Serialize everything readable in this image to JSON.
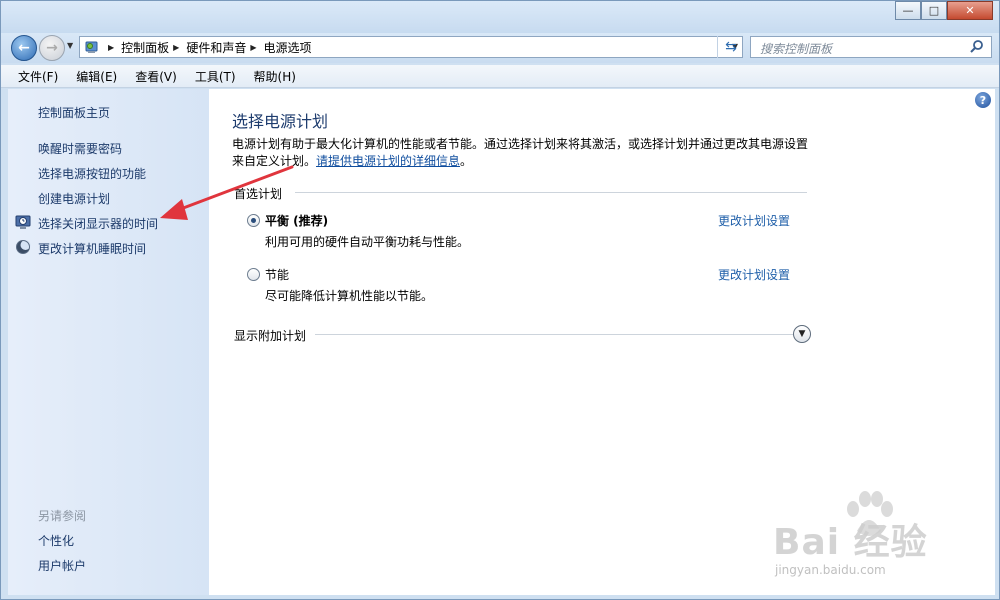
{
  "window": {
    "controls": [
      "minimize",
      "maximize",
      "close"
    ]
  },
  "navigation": {
    "breadcrumbs": [
      "控制面板",
      "硬件和声音",
      "电源选项"
    ],
    "search_placeholder": "搜索控制面板"
  },
  "menu": [
    "文件(F)",
    "编辑(E)",
    "查看(V)",
    "工具(T)",
    "帮助(H)"
  ],
  "sidebar": {
    "home": "控制面板主页",
    "links": [
      {
        "label": "唤醒时需要密码",
        "icon": ""
      },
      {
        "label": "选择电源按钮的功能",
        "icon": ""
      },
      {
        "label": "创建电源计划",
        "icon": ""
      },
      {
        "label": "选择关闭显示器的时间",
        "icon": "monitor-clock-icon"
      },
      {
        "label": "更改计算机睡眠时间",
        "icon": "moon-icon"
      }
    ],
    "see_also_title": "另请参阅",
    "see_also": [
      "个性化",
      "用户帐户"
    ]
  },
  "main": {
    "title": "选择电源计划",
    "description": "电源计划有助于最大化计算机的性能或者节能。通过选择计划来将其激活，或选择计划并通过更改其电源设置来自定义计划。",
    "description_link": "请提供电源计划的详细信息",
    "description_end": "。",
    "preferred_label": "首选计划",
    "plans": [
      {
        "name": "平衡 (推荐)",
        "description": "利用可用的硬件自动平衡功耗与性能。",
        "selected": true,
        "link": "更改计划设置"
      },
      {
        "name": "节能",
        "description": "尽可能降低计算机性能以节能。",
        "selected": false,
        "link": "更改计划设置"
      }
    ],
    "more_plans_label": "显示附加计划"
  },
  "watermark": {
    "text": "Bai 经验",
    "sub": "jingyan.baidu.com"
  },
  "colors": {
    "link": "#1f5fa9",
    "title": "#1e3c6e",
    "sidebar_bg": "#dce8f6",
    "annotation_arrow": "#e0353d"
  }
}
